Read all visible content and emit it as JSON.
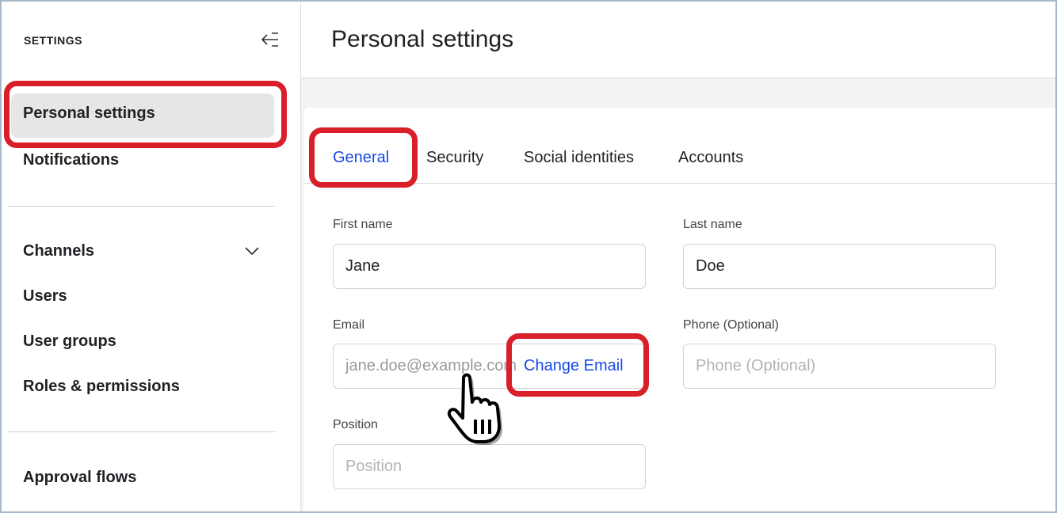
{
  "sidebar": {
    "title": "SETTINGS",
    "items": [
      {
        "label": "Personal settings",
        "active": true
      },
      {
        "label": "Notifications"
      },
      {
        "label": "Channels",
        "expandable": true
      },
      {
        "label": "Users"
      },
      {
        "label": "User groups"
      },
      {
        "label": "Roles & permissions"
      },
      {
        "label": "Approval flows"
      }
    ]
  },
  "header": {
    "title": "Personal settings"
  },
  "tabs": [
    {
      "label": "General",
      "active": true
    },
    {
      "label": "Security"
    },
    {
      "label": "Social identities"
    },
    {
      "label": "Accounts"
    }
  ],
  "form": {
    "first_name": {
      "label": "First name",
      "value": "Jane"
    },
    "last_name": {
      "label": "Last name",
      "value": "Doe"
    },
    "email": {
      "label": "Email",
      "value": "jane.doe@example.com",
      "action": "Change Email"
    },
    "phone": {
      "label": "Phone (Optional)",
      "placeholder": "Phone (Optional)"
    },
    "position": {
      "label": "Position",
      "placeholder": "Position"
    }
  },
  "colors": {
    "accent": "#1749e6",
    "highlight": "#d81f2a",
    "active_bg": "#e6e6e6"
  }
}
